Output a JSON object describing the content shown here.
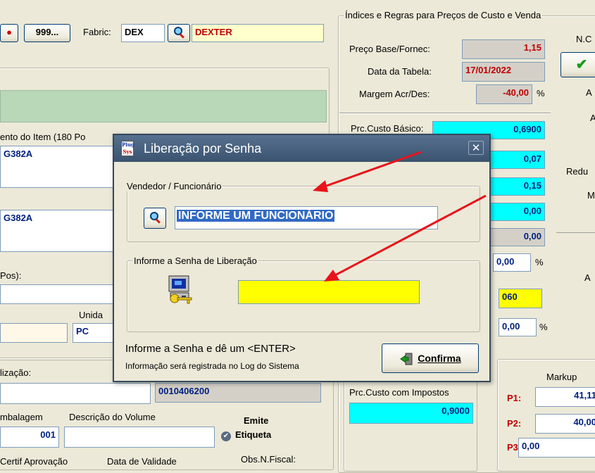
{
  "top": {
    "btn_999": "999...",
    "fabric_label": "Fabric:",
    "fabric_code": "DEX",
    "fabric_name": "DEXTER"
  },
  "left": {
    "desc_label": "ento do Item (180 Po",
    "item_code_1": "G382A",
    "item_code_2": "G382A",
    "pos_label": "Pos):",
    "unidade_label": "Unida",
    "unidade_value": "PC",
    "localizacao_label": "lização:",
    "localizacao_value": "0010406200",
    "embalagem_label": "mbalagem",
    "embalagem_value": "001",
    "volume_label": "Descrição do Volume",
    "emite_label": "Emite",
    "etiqueta_label": "Etiqueta",
    "certif_label": "Certif Aprovação",
    "validade_label": "Data de Validade",
    "obs_label": "Obs.N.Fiscal:"
  },
  "prices": {
    "group_title": "Índices e Regras para Preços de Custo e Venda",
    "preco_base_label": "Preço Base/Fornec:",
    "preco_base_value": "1,15",
    "data_tabela_label": "Data da Tabela:",
    "data_tabela_value": "17/01/2022",
    "margem_label": "Margem Acr/Des:",
    "margem_value": "-40,00",
    "pct": "%",
    "custo_basico_label": "Prc.Custo Básico:",
    "custo_basico_value": "0,6900",
    "v1": "0,07",
    "v2": "0,15",
    "v3": "0,00",
    "v4": "0,00",
    "v5": "0,00",
    "v6": "060",
    "v7": "0,00",
    "custo_impostos_label": "Prc.Custo com Impostos",
    "custo_impostos_value": "0,9000"
  },
  "right": {
    "nc_label": "N.C",
    "a1": "A",
    "a2": "A",
    "a3": "A",
    "redu": "Redu",
    "m": "M",
    "a4": "A",
    "markup_label": "Markup",
    "p1_label": "P1:",
    "p1_value": "41,11",
    "p2_label": "P2:",
    "p2_value": "40,00",
    "p3_label": "P3:",
    "p3_value": "0,00"
  },
  "dialog": {
    "title": "Liberação por Senha",
    "logo_line1": "Plug",
    "logo_line2": "Sys",
    "close": "✕",
    "vendedor_group": "Vendedor / Funcionário",
    "vendedor_value": "INFORME UM FUNCIONÁRIO",
    "senha_group": "Informe a Senha de Liberação",
    "senha_value": "",
    "hint_main": "Informe a Senha e dê um <ENTER>",
    "hint_sub": "Informação será registrada no Log do Sistema",
    "confirm_label": "Confirma"
  },
  "colors": {
    "cyan": "#00ffff",
    "yellow_input": "#ffff00",
    "light_yellow": "#ffffcc",
    "green_memo": "#b8d8b8",
    "arrow_red": "#e8141b"
  }
}
